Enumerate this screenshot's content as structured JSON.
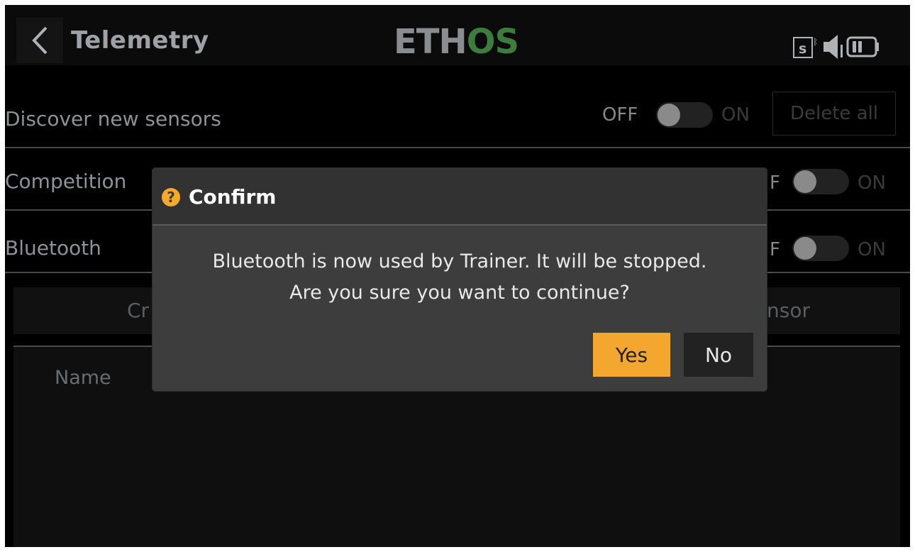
{
  "header": {
    "title": "Telemetry",
    "logo_part1": "ETH",
    "logo_part2": "OS",
    "icons": [
      "back-chevron-icon",
      "sd-card-bluetooth-icon",
      "speaker-icon",
      "battery-icon"
    ]
  },
  "rows": [
    {
      "label": "Discover new sensors",
      "off": "OFF",
      "on": "ON",
      "action": "Delete all"
    },
    {
      "label": "Competition",
      "off": "F",
      "on": "ON"
    },
    {
      "label": "Bluetooth",
      "off": "F",
      "on": "ON"
    }
  ],
  "buttons": {
    "create_partial": "Cr",
    "sensor_partial": "nsor"
  },
  "list": {
    "column_name": "Name"
  },
  "dialog": {
    "icon": "question-icon",
    "title": "Confirm",
    "message_line1": "Bluetooth is now used by Trainer. It will be stopped.",
    "message_line2": "Are you sure you want to continue?",
    "yes": "Yes",
    "no": "No"
  },
  "colors": {
    "accent": "#f4a72f",
    "logo_os": "#3c7d3d"
  }
}
